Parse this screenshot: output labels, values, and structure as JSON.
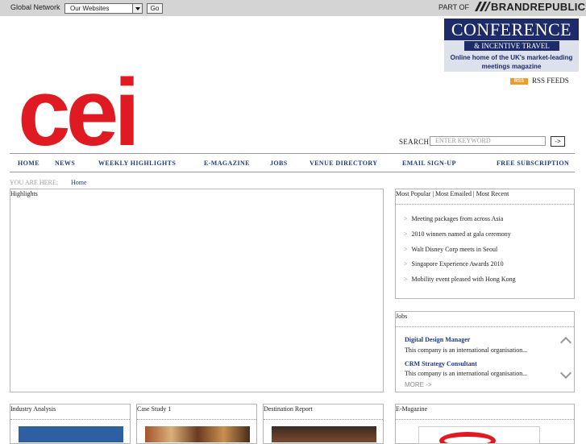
{
  "topbar": {
    "global_network_label": "Global Network",
    "websites_select_value": "Our Websites",
    "go_label": "Go",
    "part_of_label": "PART OF",
    "brand_label": "BRANDREPUBLIC"
  },
  "ad": {
    "line1": "CONFERENCE",
    "line2": "& INCENTIVE TRAVEL",
    "line3": "Online home of the UK's market-leading meetings magazine"
  },
  "rss": {
    "badge": "RSS",
    "label": "RSS FEEDS"
  },
  "logo": {
    "text": "cei",
    "color": "#e01a22"
  },
  "search": {
    "label": "SEARCH",
    "placeholder": "ENTER KEYWORD",
    "button": "->"
  },
  "nav": {
    "items": [
      "HOME",
      "NEWS",
      "WEEKLY HIGHLIGHTS",
      "E-MAGAZINE",
      "JOBS",
      "VENUE DIRECTORY",
      "EMAIL SIGN-UP",
      "FREE SUBSCRIPTION"
    ]
  },
  "breadcrumb": {
    "label": "YOU ARE HERE:",
    "home": "Home"
  },
  "highlights": {
    "title": "Highlights"
  },
  "popular": {
    "tabs": "Most Popular | Most Emailed | Most Recent",
    "items": [
      "Meeting packages from across Asia",
      "2010 winners named at gala ceremony",
      "Walt Disney Corp meets in Seoul",
      "Singapore Experience Awards 2010",
      "Mobility event pleased with Hong Kong"
    ]
  },
  "jobs": {
    "title": "Jobs",
    "items": [
      {
        "title": "Digital Design Manager",
        "desc": "This company is an international organisation..."
      },
      {
        "title": "CRM Strategy Consultant",
        "desc": "This company is an international organisation..."
      }
    ],
    "more": "MORE ->"
  },
  "bottom": {
    "industry": "Industry Analysis",
    "case_study": "Case Study 1",
    "destination": "Destination Report",
    "emagazine": "E-Magazine"
  },
  "colors": {
    "nav_blue": "#1f3a77",
    "brand_red": "#e01a22",
    "rss_orange": "#f29b2b",
    "ad_navy": "#1d2b6b"
  }
}
